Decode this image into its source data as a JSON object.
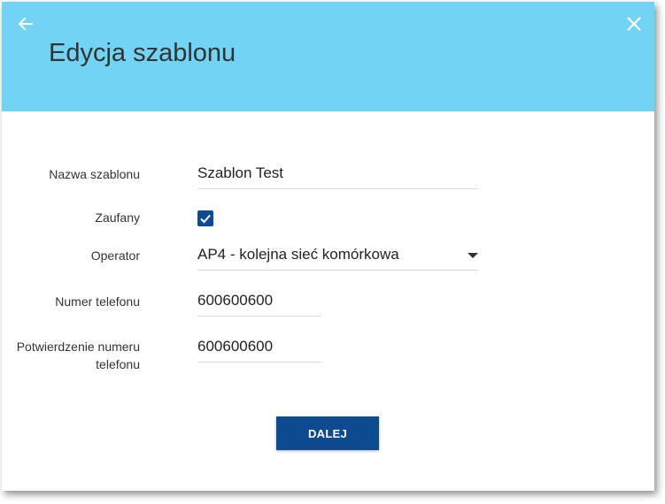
{
  "header": {
    "title": "Edycja szablonu",
    "background_color": "#72d3f5",
    "back_icon": "arrow-left-icon",
    "close_icon": "close-icon"
  },
  "form": {
    "template_name": {
      "label": "Nazwa szablonu",
      "value": "Szablon Test"
    },
    "trusted": {
      "label": "Zaufany",
      "checked": true
    },
    "operator": {
      "label": "Operator",
      "value": "AP4 - kolejna sieć komórkowa"
    },
    "phone_number": {
      "label": "Numer telefonu",
      "value": "600600600"
    },
    "phone_confirm": {
      "label_line1": "Potwierdzenie numeru",
      "label_line2": "telefonu",
      "value": "600600600"
    }
  },
  "actions": {
    "next_label": "DALEJ",
    "primary_color": "#0d4a92"
  }
}
